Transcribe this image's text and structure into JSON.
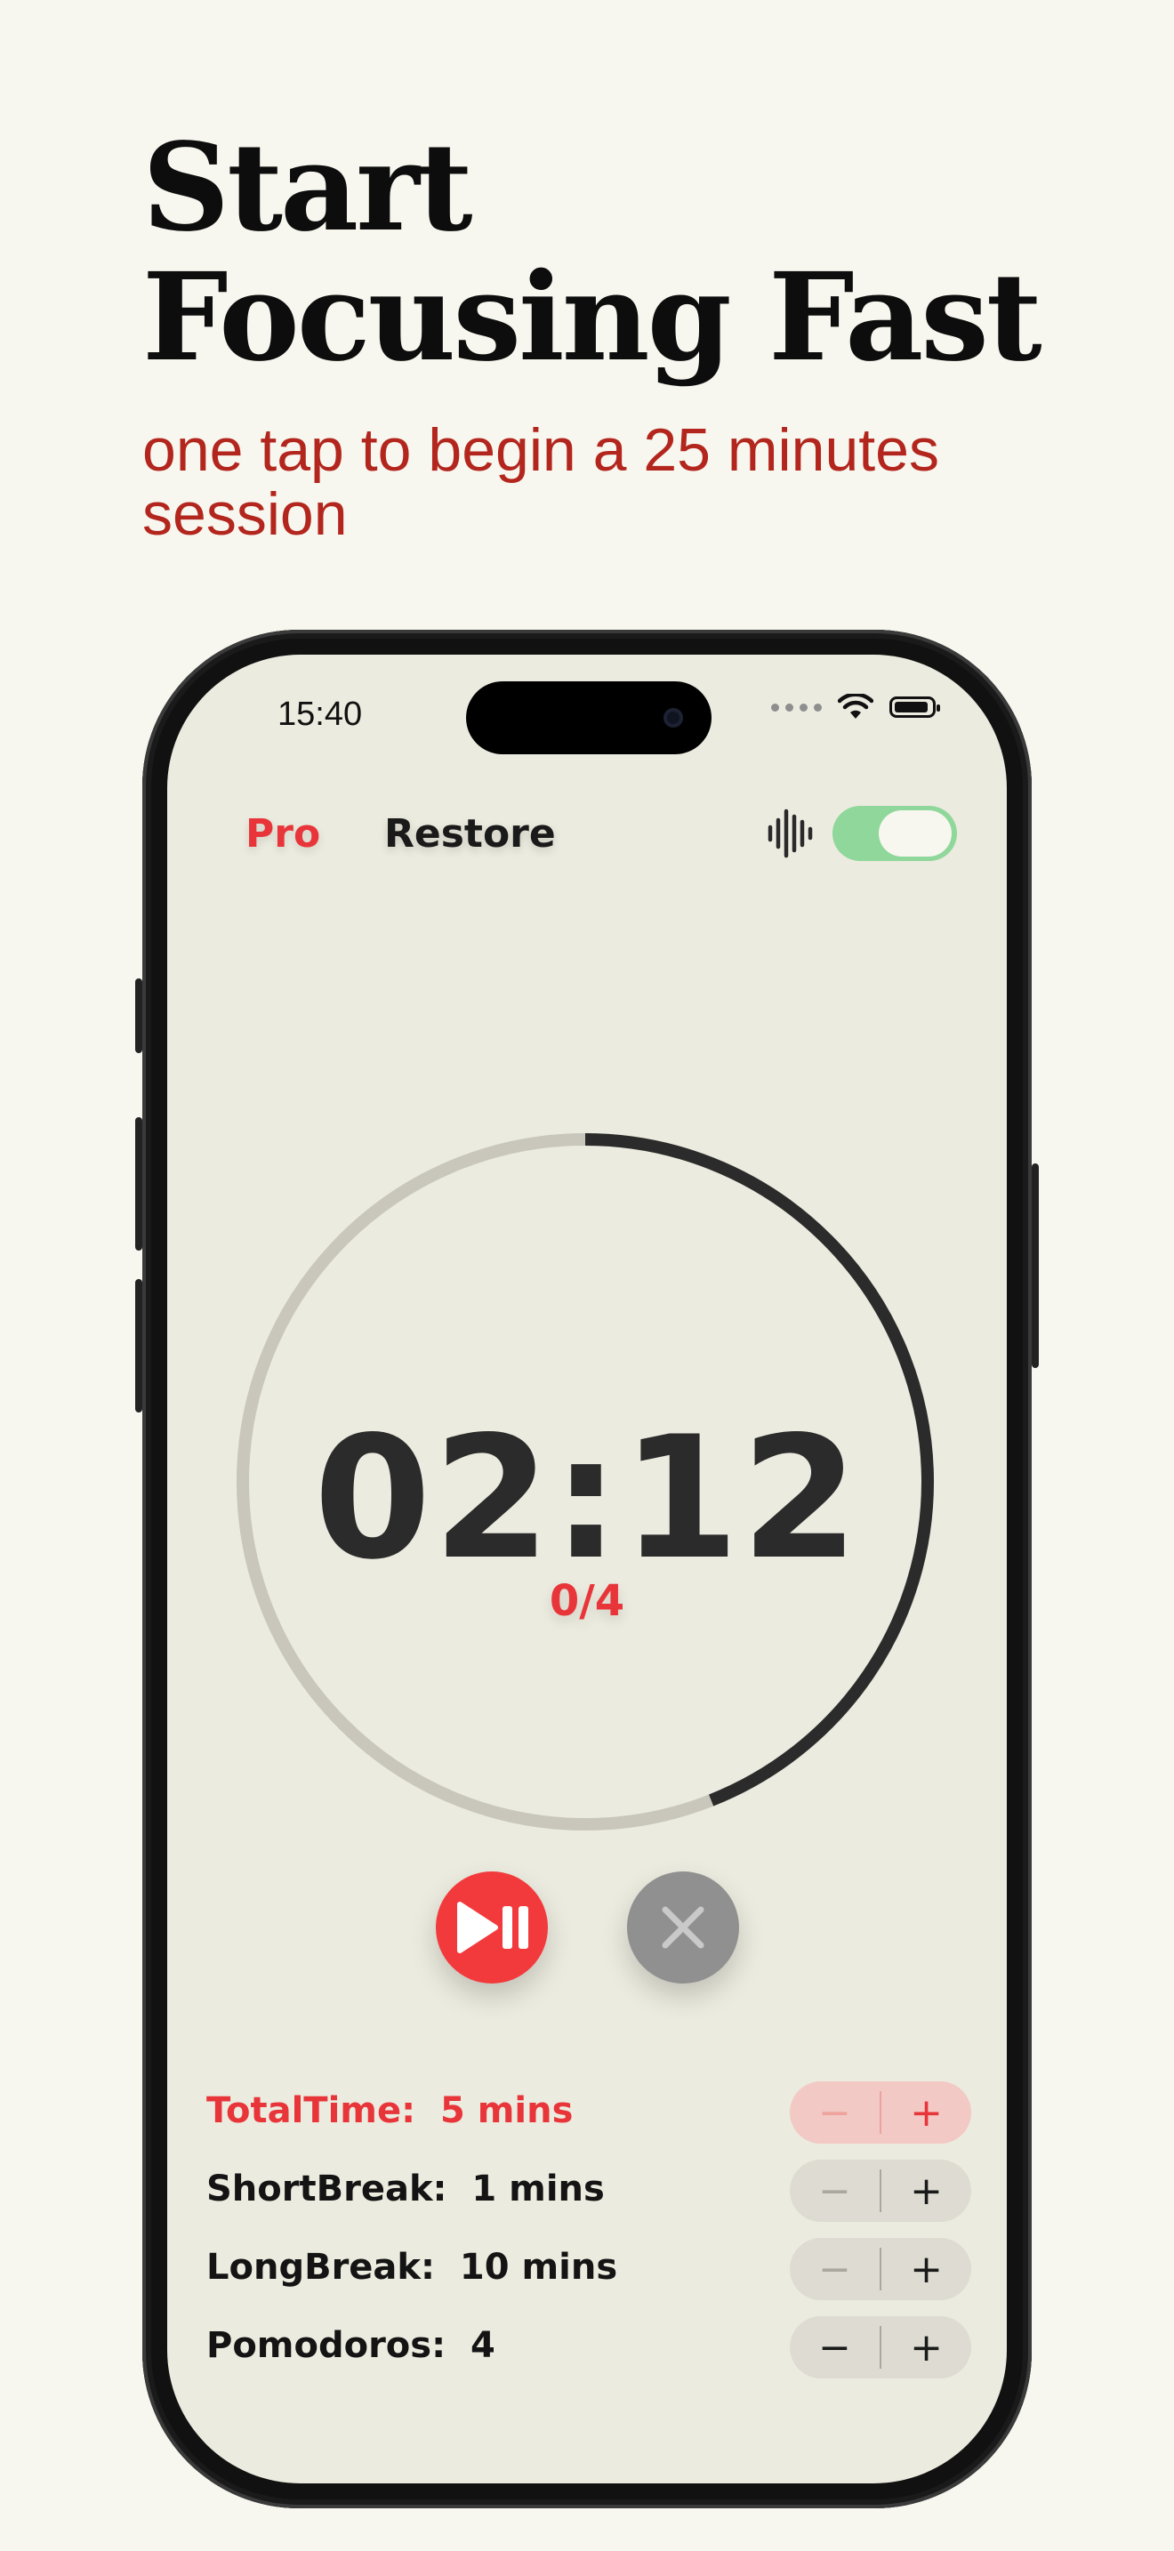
{
  "promo": {
    "headline_line1": "Start",
    "headline_line2": "Focusing Fast",
    "subheadline": "one tap to begin a 25 minutes session"
  },
  "status_bar": {
    "time": "15:40",
    "icons": [
      "signal-dots-icon",
      "wifi-icon",
      "battery-icon"
    ]
  },
  "header": {
    "pro_label": "Pro",
    "restore_label": "Restore",
    "sound_icon": "sound-wave-icon",
    "sound_toggle_on": true
  },
  "timer": {
    "time": "02:12",
    "session_count": "0/4",
    "progress_fraction": 0.44
  },
  "controls": {
    "play_pause_icon": "play-pause-icon",
    "close_icon": "close-icon"
  },
  "settings": [
    {
      "label": "TotalTime:",
      "value": "5 mins",
      "active": true
    },
    {
      "label": "ShortBreak:",
      "value": "1 mins",
      "active": false
    },
    {
      "label": "LongBreak:",
      "value": "10 mins",
      "active": false
    },
    {
      "label": "Pomodoros:",
      "value": "4",
      "active": false
    }
  ],
  "stepper": {
    "minus": "−",
    "plus": "+"
  },
  "colors": {
    "accent_red": "#e8353a",
    "headline_red": "#b3261e",
    "toggle_green": "#8fd79a",
    "screen_bg": "#ecebdf",
    "page_bg": "#f7f7ef"
  }
}
